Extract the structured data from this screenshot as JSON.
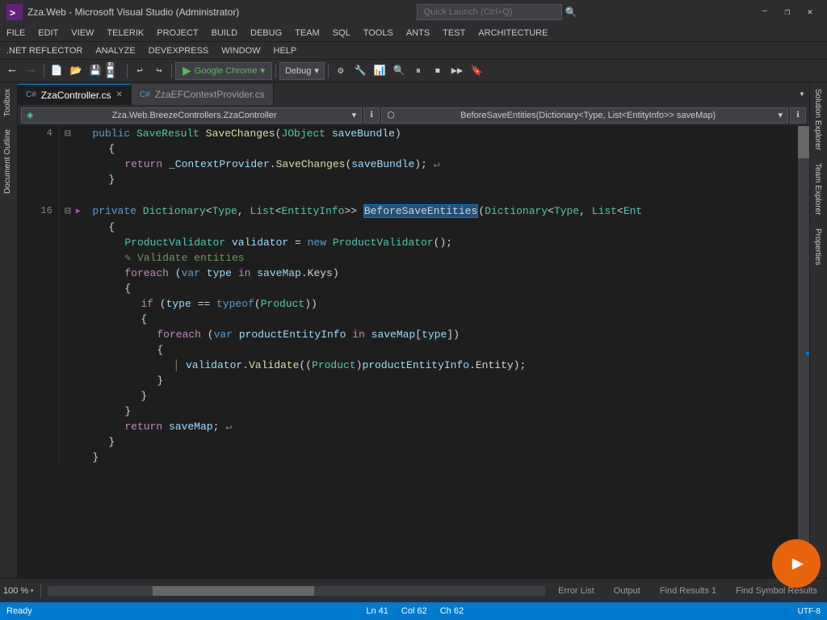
{
  "titleBar": {
    "title": "Zza.Web - Microsoft Visual Studio (Administrator)",
    "minimize": "−",
    "restore": "❐",
    "close": "✕"
  },
  "quickLaunch": {
    "placeholder": "Quick Launch (Ctrl+Q)"
  },
  "menuBar": {
    "items": [
      "FILE",
      "EDIT",
      "VIEW",
      "TELERIK",
      "PROJECT",
      "BUILD",
      "DEBUG",
      "TEAM",
      "SQL",
      "TOOLS",
      "ANTS",
      "TEST",
      "ARCHITECTURE"
    ]
  },
  "reflectorBar": {
    "items": [
      ".NET REFLECTOR",
      "ANALYZE",
      "DEVEXPRESS",
      "WINDOW",
      "HELP"
    ]
  },
  "toolbar": {
    "runTarget": "Google Chrome",
    "buildConfig": "Debug"
  },
  "tabs": {
    "active": "ZzaController.cs",
    "inactive": "ZzaEFContextProvider.cs",
    "dropdownLabel": "▾"
  },
  "navBar": {
    "left": "Zza.Web.BreezeControllers.ZzaController",
    "right": "BeforeSaveEntities(Dictionary<Type, List<EntityInfo>> saveMap)"
  },
  "codeLines": [
    {
      "ln": "4",
      "indent": 2,
      "content": "public SaveResult SaveChanges(JObject saveBundle)",
      "type": "normal"
    },
    {
      "ln": "",
      "indent": 3,
      "content": "{",
      "type": "normal"
    },
    {
      "ln": "",
      "indent": 3,
      "content": "    return _ContextProvider.SaveChanges(saveBundle);  ↵",
      "type": "normal"
    },
    {
      "ln": "",
      "indent": 3,
      "content": "}",
      "type": "normal"
    },
    {
      "ln": "",
      "indent": 0,
      "content": "",
      "type": "blank"
    },
    {
      "ln": "16",
      "indent": 2,
      "content": "private Dictionary<Type, List<EntityInfo>> BeforeSaveEntities(Dictionary<Type, List<Ent",
      "type": "normal"
    },
    {
      "ln": "",
      "indent": 3,
      "content": "{",
      "type": "normal"
    },
    {
      "ln": "",
      "indent": 3,
      "content": "    ProductValidator validator = new ProductValidator();",
      "type": "normal"
    },
    {
      "ln": "",
      "indent": 3,
      "content": "    ✎  Validate entities",
      "type": "comment-line"
    },
    {
      "ln": "",
      "indent": 3,
      "content": "    foreach (var type in saveMap.Keys)",
      "type": "normal"
    },
    {
      "ln": "",
      "indent": 3,
      "content": "    {",
      "type": "normal"
    },
    {
      "ln": "",
      "indent": 4,
      "content": "        if (type == typeof(Product))",
      "type": "normal"
    },
    {
      "ln": "",
      "indent": 4,
      "content": "        {",
      "type": "normal"
    },
    {
      "ln": "",
      "indent": 5,
      "content": "            foreach (var productEntityInfo in saveMap[type])",
      "type": "normal"
    },
    {
      "ln": "",
      "indent": 5,
      "content": "            {",
      "type": "normal"
    },
    {
      "ln": "",
      "indent": 6,
      "content": "                │  validator.Validate((Product)productEntityInfo.Entity);",
      "type": "normal"
    },
    {
      "ln": "",
      "indent": 5,
      "content": "            }",
      "type": "normal"
    },
    {
      "ln": "",
      "indent": 4,
      "content": "        }",
      "type": "normal"
    },
    {
      "ln": "",
      "indent": 3,
      "content": "    }",
      "type": "normal"
    },
    {
      "ln": "",
      "indent": 3,
      "content": "    return saveMap;  ↵",
      "type": "normal"
    },
    {
      "ln": "",
      "indent": 2,
      "content": "}",
      "type": "normal"
    },
    {
      "ln": "",
      "indent": 0,
      "content": "}",
      "type": "normal"
    }
  ],
  "bottomPanel": {
    "tabs": [
      "Error List",
      "Output",
      "Find Results 1",
      "Find Symbol Results"
    ]
  },
  "statusBar": {
    "ready": "Ready",
    "ln": "Ln 41",
    "col": "Col 62",
    "ch": "Ch 62"
  },
  "zoom": {
    "level": "100 %"
  },
  "rightSidebar": {
    "tabs": [
      "Solution Explorer",
      "Team Explorer",
      "Properties"
    ]
  },
  "leftSidebar": {
    "tabs": [
      "Toolbox",
      "Document Outline"
    ]
  }
}
